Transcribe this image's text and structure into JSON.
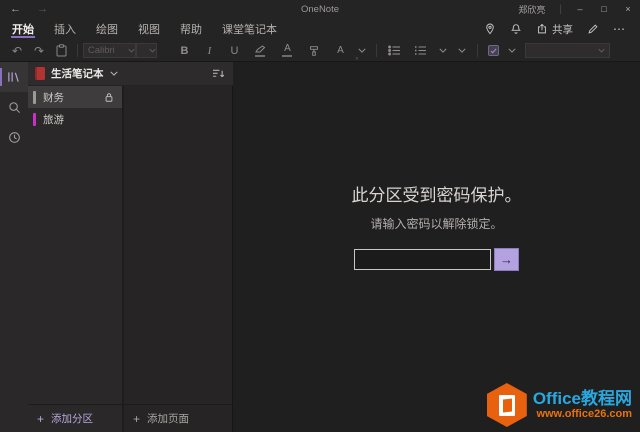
{
  "titlebar": {
    "app_title": "OneNote",
    "user_name": "郑欣亮",
    "separator": "|",
    "back": "←",
    "forward": "→",
    "minimize": "–",
    "maximize": "□",
    "close": "×"
  },
  "menubar": {
    "tabs": [
      {
        "label": "开始",
        "active": true
      },
      {
        "label": "插入",
        "active": false
      },
      {
        "label": "绘图",
        "active": false
      },
      {
        "label": "视图",
        "active": false
      },
      {
        "label": "帮助",
        "active": false
      },
      {
        "label": "课堂笔记本",
        "active": false
      }
    ],
    "share_label": "共享",
    "more": "⋯"
  },
  "toolbar": {
    "undo": "↶",
    "redo": "↷",
    "font_name": "Calibri",
    "font_size": "",
    "bold": "B",
    "italic": "I",
    "underline": "U",
    "font_color": "A",
    "clear_format": "A",
    "clear_format_sub": "ₓ"
  },
  "sidebar": {
    "notebook_name": "生活笔记本",
    "sections": [
      {
        "label": "财务",
        "color": "#9e9a96",
        "locked": true,
        "selected": true
      },
      {
        "label": "旅游",
        "color": "#c92fc9",
        "locked": false,
        "selected": false
      }
    ],
    "plus": "+",
    "add_section": "添加分区",
    "add_page": "添加页面"
  },
  "main": {
    "lock_title": "此分区受到密码保护。",
    "lock_subtitle": "请输入密码以解除锁定。",
    "password_value": "",
    "submit_arrow": "→"
  },
  "watermark": {
    "title": "Office教程网",
    "url": "www.office26.com"
  },
  "colors": {
    "accent": "#8b6fc0",
    "unlock_button": "#b4a2e0",
    "section_finance_bar": "#9e9a96",
    "section_travel_bar": "#c92fc9",
    "watermark_blue": "#29a8e0",
    "watermark_orange": "#e8610f"
  }
}
